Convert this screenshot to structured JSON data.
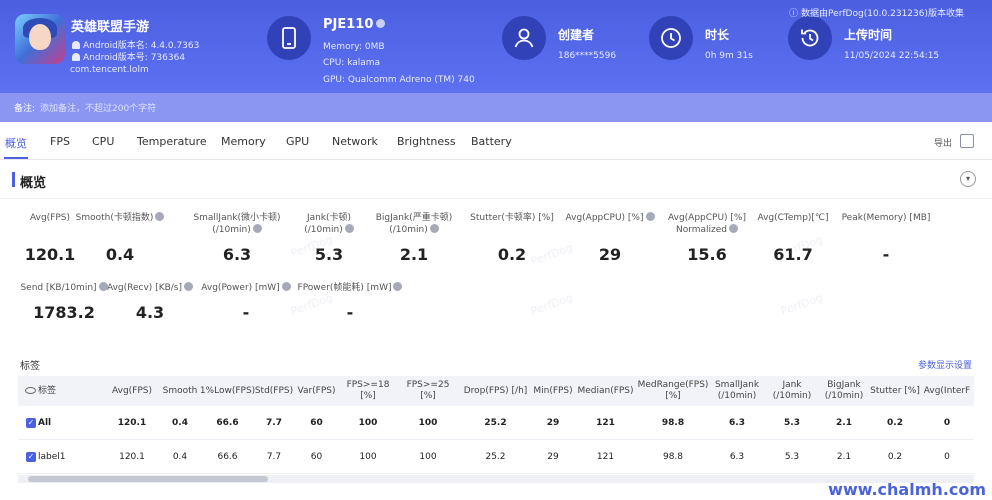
{
  "app": {
    "name": "英雄联盟手游",
    "android_version": "Android版本名: 4.4.0.7363",
    "android_code": "Android版本号: 736364",
    "package": "com.tencent.lolm"
  },
  "device": {
    "name": "PJE110",
    "memory": "Memory: 0MB",
    "cpu": "CPU: kalama",
    "gpu": "GPU: Qualcomm Adreno (TM) 740"
  },
  "creator": {
    "title": "创建者",
    "value": "186****5596"
  },
  "duration": {
    "title": "时长",
    "value": "0h 9m 31s"
  },
  "upload": {
    "title": "上传时间",
    "value": "11/05/2024 22:54:15"
  },
  "source": "数据由PerfDog(10.0.231236)版本收集",
  "note": {
    "label": "备注:",
    "placeholder": "添加备注，不超过200个字符"
  },
  "tabs": [
    "概览",
    "FPS",
    "CPU",
    "Temperature",
    "Memory",
    "GPU",
    "Network",
    "Brightness",
    "Battery"
  ],
  "export_label": "导出",
  "section_title": "概览",
  "metrics_row1": [
    {
      "label": "Avg(FPS)",
      "value": "120.1"
    },
    {
      "label": "Smooth(卡顿指数)",
      "value": "0.4"
    },
    {
      "label": "SmallJank(微小卡顿)\n(/10min)",
      "value": "6.3"
    },
    {
      "label": "Jank(卡顿)\n(/10min)",
      "value": "5.3"
    },
    {
      "label": "BigJank(严重卡顿)\n(/10min)",
      "value": "2.1"
    },
    {
      "label": "Stutter(卡顿率) [%]",
      "value": "0.2"
    },
    {
      "label": "Avg(AppCPU) [%]",
      "value": "29"
    },
    {
      "label": "Avg(AppCPU) [%]\nNormalized",
      "value": "15.6"
    },
    {
      "label": "Avg(CTemp)[℃]",
      "value": "61.7"
    },
    {
      "label": "Peak(Memory) [MB]",
      "value": "-"
    }
  ],
  "metrics_row2": [
    {
      "label": "Send [KB/10min]",
      "value": "1783.2"
    },
    {
      "label": "Avg(Recv) [KB/s]",
      "value": "4.3"
    },
    {
      "label": "Avg(Power) [mW]",
      "value": "-"
    },
    {
      "label": "FPower(帧能耗) [mW]",
      "value": "-"
    }
  ],
  "watermark": "PerfDog",
  "tags_title": "标签",
  "param_link": "参数显示设置",
  "table": {
    "headers": [
      "标签",
      "Avg(FPS)",
      "Smooth",
      "1%Low(FPS)",
      "Std(FPS)",
      "Var(FPS)",
      "FPS>=18 [%]",
      "FPS>=25 [%]",
      "Drop(FPS) [/h]",
      "Min(FPS)",
      "Median(FPS)",
      "MedRange(FPS)[%]",
      "SmallJank\n(/10min)",
      "Jank\n(/10min)",
      "BigJank\n(/10min)",
      "Stutter [%]",
      "Avg(InterF"
    ],
    "rows": [
      [
        "All",
        "120.1",
        "0.4",
        "66.6",
        "7.7",
        "60",
        "100",
        "100",
        "25.2",
        "29",
        "121",
        "98.8",
        "6.3",
        "5.3",
        "2.1",
        "0.2",
        "0"
      ],
      [
        "label1",
        "120.1",
        "0.4",
        "66.6",
        "7.7",
        "60",
        "100",
        "100",
        "25.2",
        "29",
        "121",
        "98.8",
        "6.3",
        "5.3",
        "2.1",
        "0.2",
        "0"
      ]
    ]
  },
  "site_mark": "www.chalmh.com"
}
